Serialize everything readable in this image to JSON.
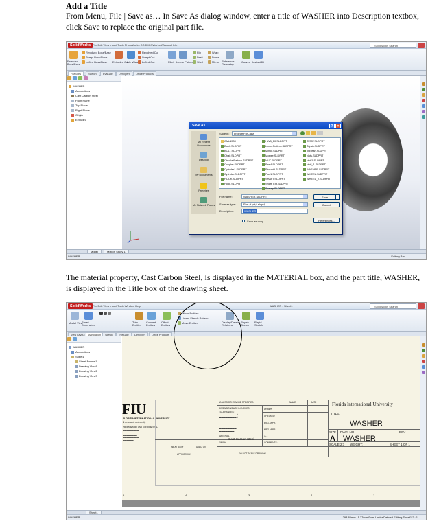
{
  "doc": {
    "heading": "Add a Title",
    "para1": "From Menu, File | Save as… In Save As dialog window, enter a title of WASHER into Description textbox, click Save to replace the original part file.",
    "para2": "The material property, Cast Carbon Steel, is displayed in the MATERIAL box, and the part title, WASHER, is displayed in the Title box of the drawing sheet."
  },
  "shot1": {
    "app_name": "SolidWorks",
    "menu": "File   Edit   View   Insert   Tools   PhotoWorks   COSMOSWorks   Window   Help",
    "search": "SolidWorks Search",
    "ribbon": {
      "items": [
        "Revolved Boss/Base",
        "Swept Boss/Base",
        "Lofted Boss/Base",
        "Extruded Cut",
        "Hole Wizard",
        "Revolved Cut",
        "Swept Cut",
        "Lofted Cut",
        "Fillet",
        "Linear Pattern",
        "Rib",
        "Draft",
        "Shell",
        "Wrap",
        "Dome",
        "Mirror",
        "Reference Geometry",
        "Curves",
        "Instant3D"
      ],
      "big": [
        "Extruded Boss/Base",
        "Extruded Cut",
        "Hole Wizard"
      ]
    },
    "tabs": [
      "Features",
      "Sketch",
      "Evaluate",
      "DimXpert",
      "Office Products"
    ],
    "tree": [
      "WASHER",
      "Annotations",
      "Cast Carbon Steel",
      "Front Plane",
      "Top Plane",
      "Right Plane",
      "Origin",
      "Extrude1"
    ],
    "dialog": {
      "title": "Save As",
      "save_in_label": "Save in:",
      "save_in_value": "projectsForClass",
      "places": [
        "My Recent Documents",
        "Desktop",
        "My Documents",
        "Favorites",
        "My Network Places"
      ],
      "files_col1": [
        "CML1530",
        "Bush.SLDPRT",
        "BOLT.SLDPRT",
        "Chair.SLDPRT",
        "CircularPattern.SLDPRT",
        "Coupler.SLDPRT",
        "Cylinder1.SLDPRT",
        "Cylinder.SLDPRT",
        "HOOK.SLDPRT",
        "Hook.SLDPRT"
      ],
      "files_col2": [
        "HW3_10.SLDPRT",
        "LinearPattern.SLDPRT",
        "Mirror.SLDPRT",
        "Mouse.SLDPRT",
        "NUT.SLDPRT",
        "Part4.SLDPRT",
        "Pinsmid.SLDPRT",
        "Part1.SLDPRT",
        "SHAFT.SLDPRT",
        "Shaft_Ext.SLDPRT",
        "Sweep.SLDPRT"
      ],
      "files_col3": [
        "TEMP.SLDPRT",
        "Tripsh.SLDPRT",
        "Triplesh.SLDPRT",
        "Nuts.SLDPRT",
        "stuff1.SLDPRT",
        "stuff_1.SLDPRT",
        "WASHER.SLDPRT",
        "WHEEL.SLDPRT",
        "WHEEL_2.SLDPRT"
      ],
      "file_name_label": "File name:",
      "file_name_value": "WASHER.SLDPRT",
      "save_type_label": "Save as type:",
      "save_type_value": "Part (*.prt;*.sldprt)",
      "description_label": "Description:",
      "description_value": "WASHER",
      "save_btn": "Save",
      "cancel_btn": "Cancel",
      "references_btn": "References...",
      "save_copy_label": "Save as copy"
    },
    "bottom_tabs": [
      "Model",
      "Motion Study 1"
    ],
    "status_left": "WASHER",
    "status_right": "Editing Part"
  },
  "shot2": {
    "app_name": "SolidWorks",
    "menu": "File   Edit   View   Insert   Tools   Window   Help",
    "title": "WASHER - Sheet1",
    "search": "SolidWorks Search",
    "ribbon": [
      "Model View",
      "Smart Dimension",
      "Trim Entities",
      "Convert Entities",
      "Offset Entities",
      "Mirror Entities",
      "Linear Sketch Pattern",
      "Move Entities",
      "Display/Delete Relations",
      "Repair Sketch",
      "Rapid Sketch"
    ],
    "tabs": [
      "View Layout",
      "Annotation",
      "Sketch",
      "Evaluate",
      "DimXpert",
      "Office Products"
    ],
    "tree": [
      "WASHER",
      "Annotations",
      "Sheet1",
      "Sheet Format1",
      "Drawing View1",
      "Drawing View2",
      "Drawing View3"
    ],
    "title_block": {
      "university": "Florida International University",
      "title_label": "TITLE:",
      "title_value": "WASHER",
      "size_label": "SIZE",
      "size_value": "A",
      "dwg_label": "DWG.  NO.",
      "dwg_value": "WASHER",
      "rev_label": "REV",
      "scale": "SCALE:2:1",
      "weight": "WEIGHT:",
      "sheet": "SHEET 1 OF 1",
      "material_label": "MATERIAL",
      "material_value": "Cast Carbon Steel",
      "finish_label": "FINISH",
      "unless": "UNLESS OTHERWISE SPECIFIED:",
      "dims": "DIMENSIONS ARE IN INCHES",
      "tolerances": "TOLERANCES:",
      "name_col": "NAME",
      "date_col": "DATE",
      "drawn": "DRAWN",
      "checked": "CHECKED",
      "eng_appr": "ENG APPR.",
      "mfg_appr": "MFG APPR.",
      "qa": "Q.A.",
      "comments": "COMMENTS:",
      "next_assy": "NEXT ASSY",
      "used_on": "USED ON",
      "application": "APPLICATION",
      "do_not_scale": "DO NOT SCALE DRAWING",
      "fiu_logo": "FIU",
      "fiu_sub1": "FLORIDA INTERNATIONAL UNIVERSITY",
      "fiu_sub2": "& research university",
      "proprietary": "PROPRIETARY AND CONFIDENTIAL"
    },
    "zones": [
      "5",
      "4",
      "3",
      "2",
      "1"
    ],
    "bottom_tab": "Sheet1",
    "status_left": "WASHER",
    "status_right": "293.84mm   11.37mm   0mm   Under Defined   Editing Sheet1   2 : 1"
  },
  "colors": {
    "sw_red": "#c21d1d",
    "dialog_title": "#0a4bc4",
    "selection": "#316ac5",
    "sheet": "#f6f3e4"
  }
}
